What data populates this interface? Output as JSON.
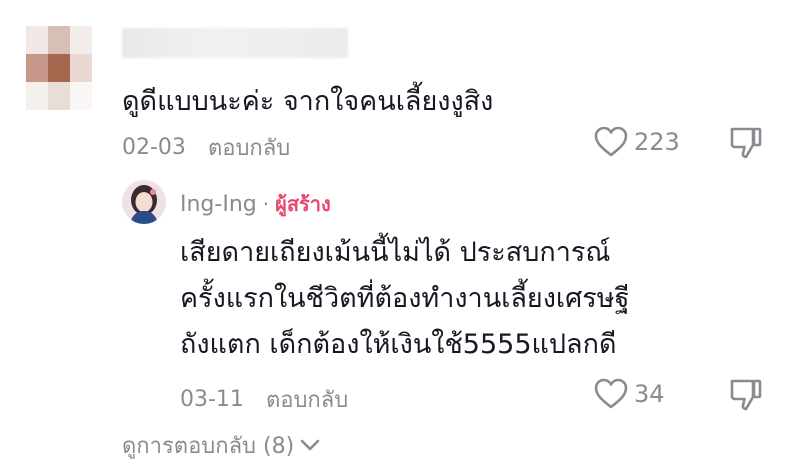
{
  "comment": {
    "username": "",
    "text": "ดูดีแบบนะค่ะ จากใจคนเลี้ยงงูสิง",
    "date": "02-03",
    "reply_label": "ตอบกลับ",
    "like_count": "223"
  },
  "reply": {
    "username": "Ing-Ing",
    "separator": "·",
    "creator_badge": "ผู้สร้าง",
    "lines": [
      "เสียดายเถียงเม้นนี้ไม่ได้ ประสบการณ์",
      "ครั้งแรกในชีวิตที่ต้องทำงานเลี้ยงเศรษฐี",
      "ถังแตก เด็กต้องให้เงินใช้5555แปลกดี"
    ],
    "date": "03-11",
    "reply_label": "ตอบกลับ",
    "like_count": "34"
  },
  "view_replies_label": "ดูการตอบกลับ (8)",
  "icons": {
    "like": "heart-outline-icon",
    "dislike": "thumbs-down-outline-icon",
    "expand": "chevron-down-icon"
  },
  "colors": {
    "text": "#161823",
    "meta": "#8a8b91",
    "creator": "#e8486b"
  }
}
